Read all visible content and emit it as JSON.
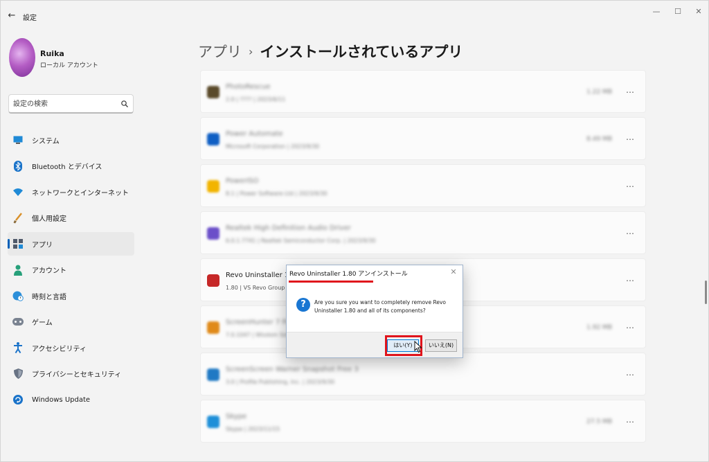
{
  "window": {
    "title": "設定",
    "back_icon": "←",
    "minimize_icon": "—",
    "maximize_icon": "☐",
    "close_icon": "✕"
  },
  "profile": {
    "name": "Ruika",
    "account_type": "ローカル アカウント"
  },
  "search": {
    "placeholder": "設定の検索"
  },
  "sidebar": {
    "items": [
      {
        "label": "システム",
        "icon": "system-icon",
        "active": false
      },
      {
        "label": "Bluetooth とデバイス",
        "icon": "bluetooth-icon",
        "active": false
      },
      {
        "label": "ネットワークとインターネット",
        "icon": "wifi-icon",
        "active": false
      },
      {
        "label": "個人用設定",
        "icon": "brush-icon",
        "active": false
      },
      {
        "label": "アプリ",
        "icon": "apps-icon",
        "active": true
      },
      {
        "label": "アカウント",
        "icon": "person-icon",
        "active": false
      },
      {
        "label": "時刻と言語",
        "icon": "globe-clock-icon",
        "active": false
      },
      {
        "label": "ゲーム",
        "icon": "gamepad-icon",
        "active": false
      },
      {
        "label": "アクセシビリティ",
        "icon": "accessibility-icon",
        "active": false
      },
      {
        "label": "プライバシーとセキュリティ",
        "icon": "shield-icon",
        "active": false
      },
      {
        "label": "Windows Update",
        "icon": "update-icon",
        "active": false
      }
    ]
  },
  "breadcrumb": {
    "parent": "アプリ",
    "separator": "›",
    "current": "インストールされているアプリ"
  },
  "apps": [
    {
      "name": "PhotoRescue",
      "meta": "2.0 | ???? | 2023/6/11",
      "size": "1.22 MB",
      "icon_color": "#5a4a2a",
      "blurred": true
    },
    {
      "name": "Power Automate",
      "meta": "Microsoft Corporation | 2023/9/30",
      "size": "8.49 MB",
      "icon_color": "#0f5fc4",
      "blurred": true
    },
    {
      "name": "PowerISO",
      "meta": "8.1 | Power Software Ltd | 2023/9/30",
      "size": "",
      "icon_color": "#f2b400",
      "blurred": true
    },
    {
      "name": "Realtek High Definition Audio Driver",
      "meta": "6.0.1.7741 | Realtek Semiconductor Corp. | 2023/9/30",
      "size": "",
      "icon_color": "#6b4fc9",
      "blurred": true
    },
    {
      "name": "Revo Uninstaller 1.80",
      "meta": "1.80 | VS Revo Group |",
      "size": "",
      "icon_color": "#c62828",
      "blurred": false
    },
    {
      "name": "ScreenHunter 7 Free",
      "meta": "7.0.1047 | Wisdom Software | 2023/9/30",
      "size": "1.92 MB",
      "icon_color": "#e08a1a",
      "blurred": true
    },
    {
      "name": "ScreenScreen Warner Snapshot Free 3",
      "meta": "3.0 | Profile Publishing, Inc. | 2023/9/30",
      "size": "",
      "icon_color": "#1f79c4",
      "blurred": true
    },
    {
      "name": "Skype",
      "meta": "Skype | 2023/11/15",
      "size": "27.5 MB",
      "icon_color": "#1e8fd8",
      "blurred": true
    }
  ],
  "more_icon": "⋯",
  "dialog": {
    "title": "Revo Uninstaller 1.80 アンインストール",
    "close_icon": "✕",
    "question_icon": "?",
    "message": "Are you sure you want to completely remove Revo Uninstaller 1.80 and all of its components?",
    "yes_label": "はい(Y)",
    "no_label": "いいえ(N)"
  },
  "colors": {
    "accent": "#005fb8",
    "highlight": "#e0141c",
    "question": "#1976d2"
  }
}
